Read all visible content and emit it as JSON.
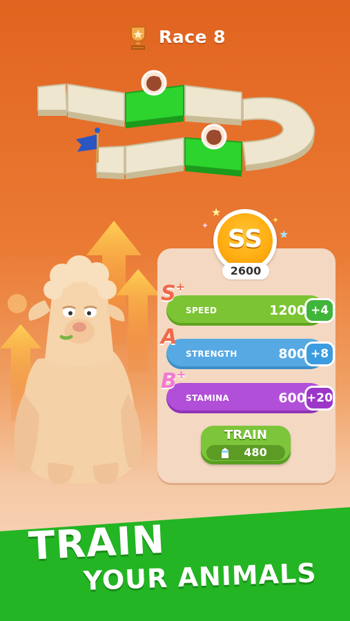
{
  "header": {
    "title": "Race 8",
    "icon": "trophy-icon"
  },
  "track": {
    "flag_icon": "blue-flag-icon",
    "racer_icons": [
      "animal-token-icon",
      "animal-token-icon"
    ]
  },
  "overall_grade": {
    "grade": "SS",
    "score": "2600"
  },
  "stats": [
    {
      "grade": "S",
      "grade_mod": "+",
      "name": "SPEED",
      "value": "1200",
      "bonus": "+4",
      "color": "#7cc433"
    },
    {
      "grade": "A",
      "grade_mod": "",
      "name": "STRENGTH",
      "value": "800",
      "bonus": "+8",
      "color": "#56a9e3"
    },
    {
      "grade": "B",
      "grade_mod": "+",
      "name": "STAMINA",
      "value": "600",
      "bonus": "+20",
      "color": "#b14fd8"
    }
  ],
  "train_button": {
    "label": "TRAIN",
    "cost": "480",
    "cost_icon": "milk-carton-icon"
  },
  "banner": {
    "line1": "TRAIN",
    "line2": "YOUR ANIMALS",
    "color": "#23b523"
  }
}
